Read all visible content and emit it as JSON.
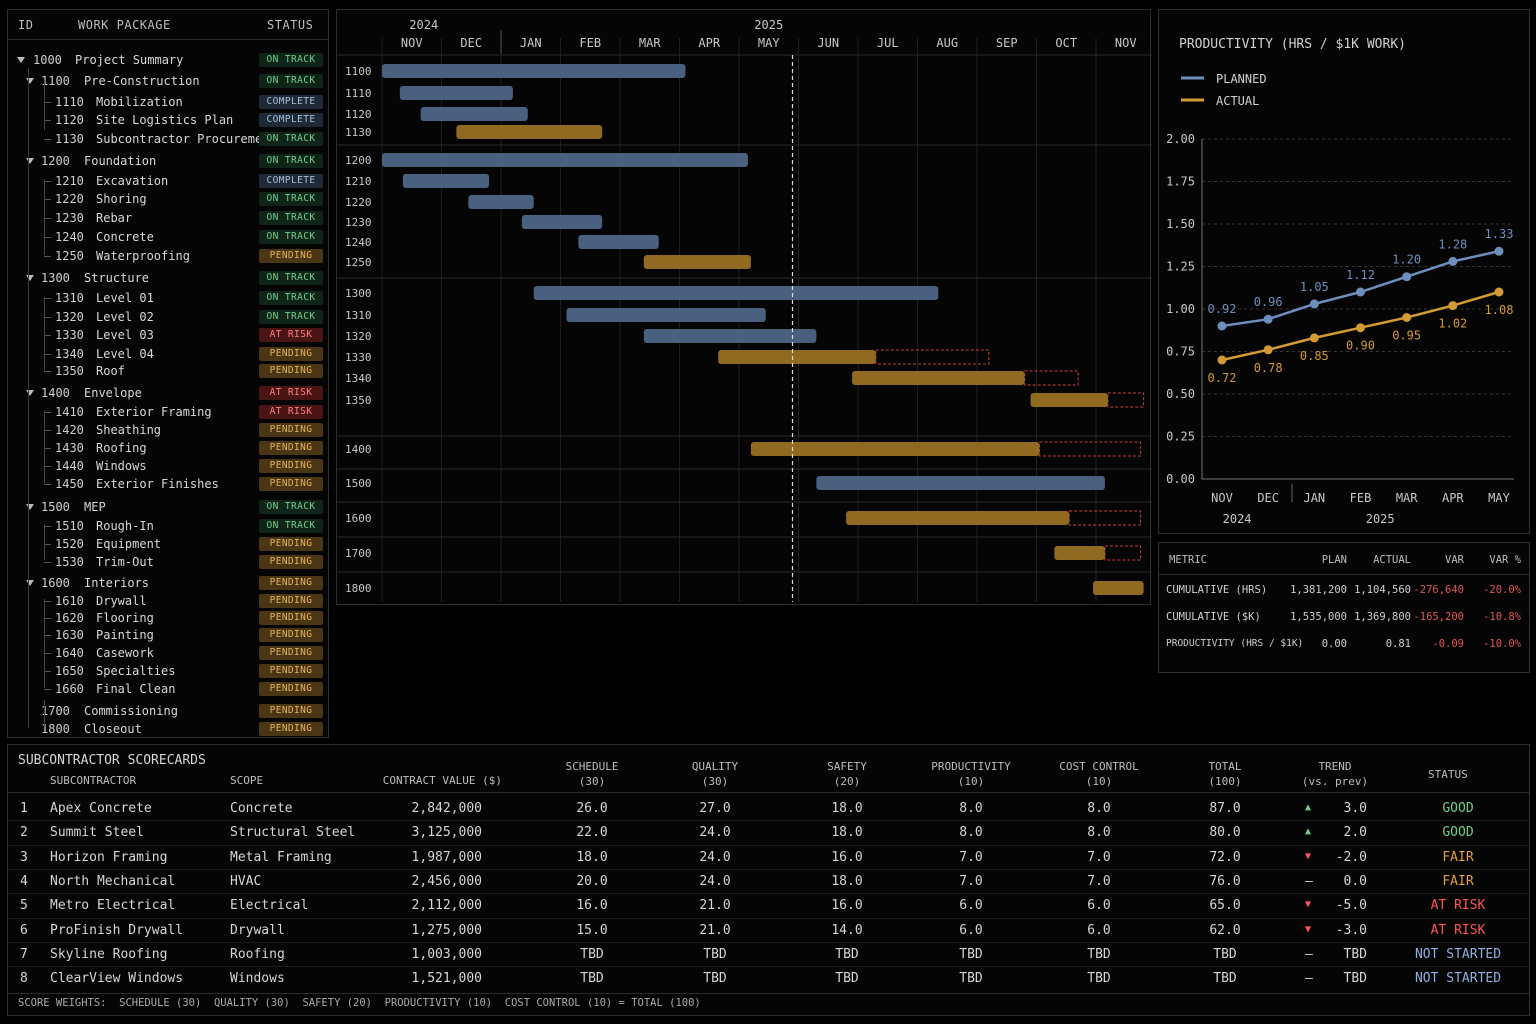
{
  "wbs": {
    "headers": {
      "id": "ID",
      "work_package": "WORK PACKAGE",
      "status": "STATUS"
    },
    "rows": [
      {
        "id": "1000",
        "name": "Project Summary",
        "status": "ON TRACK",
        "level": 0,
        "expand": true
      },
      {
        "id": "1100",
        "name": "Pre-Construction",
        "status": "ON TRACK",
        "level": 1,
        "expand": true
      },
      {
        "id": "1110",
        "name": "Mobilization",
        "status": "COMPLETE",
        "level": 2
      },
      {
        "id": "1120",
        "name": "Site Logistics Plan",
        "status": "COMPLETE",
        "level": 2
      },
      {
        "id": "1130",
        "name": "Subcontractor Procurement",
        "status": "ON TRACK",
        "level": 2
      },
      {
        "id": "1200",
        "name": "Foundation",
        "status": "ON TRACK",
        "level": 1,
        "expand": true
      },
      {
        "id": "1210",
        "name": "Excavation",
        "status": "COMPLETE",
        "level": 2
      },
      {
        "id": "1220",
        "name": "Shoring",
        "status": "ON TRACK",
        "level": 2
      },
      {
        "id": "1230",
        "name": "Rebar",
        "status": "ON TRACK",
        "level": 2
      },
      {
        "id": "1240",
        "name": "Concrete",
        "status": "ON TRACK",
        "level": 2
      },
      {
        "id": "1250",
        "name": "Waterproofing",
        "status": "PENDING",
        "level": 2
      },
      {
        "id": "1300",
        "name": "Structure",
        "status": "ON TRACK",
        "level": 1,
        "expand": true
      },
      {
        "id": "1310",
        "name": "Level 01",
        "status": "ON TRACK",
        "level": 2
      },
      {
        "id": "1320",
        "name": "Level 02",
        "status": "ON TRACK",
        "level": 2
      },
      {
        "id": "1330",
        "name": "Level 03",
        "status": "AT RISK",
        "level": 2
      },
      {
        "id": "1340",
        "name": "Level 04",
        "status": "PENDING",
        "level": 2
      },
      {
        "id": "1350",
        "name": "Roof",
        "status": "PENDING",
        "level": 2
      },
      {
        "id": "1400",
        "name": "Envelope",
        "status": "AT RISK",
        "level": 1,
        "expand": true
      },
      {
        "id": "1410",
        "name": "Exterior Framing",
        "status": "AT RISK",
        "level": 2
      },
      {
        "id": "1420",
        "name": "Sheathing",
        "status": "PENDING",
        "level": 2
      },
      {
        "id": "1430",
        "name": "Roofing",
        "status": "PENDING",
        "level": 2
      },
      {
        "id": "1440",
        "name": "Windows",
        "status": "PENDING",
        "level": 2
      },
      {
        "id": "1450",
        "name": "Exterior Finishes",
        "status": "PENDING",
        "level": 2
      },
      {
        "id": "1500",
        "name": "MEP",
        "status": "ON TRACK",
        "level": 1,
        "expand": true
      },
      {
        "id": "1510",
        "name": "Rough-In",
        "status": "ON TRACK",
        "level": 2
      },
      {
        "id": "1520",
        "name": "Equipment",
        "status": "PENDING",
        "level": 2
      },
      {
        "id": "1530",
        "name": "Trim-Out",
        "status": "PENDING",
        "level": 2
      },
      {
        "id": "1600",
        "name": "Interiors",
        "status": "PENDING",
        "level": 1,
        "expand": true
      },
      {
        "id": "1610",
        "name": "Drywall",
        "status": "PENDING",
        "level": 2
      },
      {
        "id": "1620",
        "name": "Flooring",
        "status": "PENDING",
        "level": 2
      },
      {
        "id": "1630",
        "name": "Painting",
        "status": "PENDING",
        "level": 2
      },
      {
        "id": "1640",
        "name": "Casework",
        "status": "PENDING",
        "level": 2
      },
      {
        "id": "1650",
        "name": "Specialties",
        "status": "PENDING",
        "level": 2
      },
      {
        "id": "1660",
        "name": "Final Clean",
        "status": "PENDING",
        "level": 2
      },
      {
        "id": "1700",
        "name": "Commissioning",
        "status": "PENDING",
        "level": 1
      },
      {
        "id": "1800",
        "name": "Closeout",
        "status": "PENDING",
        "level": 1
      }
    ]
  },
  "colors": {
    "planned": "#6e8fbd",
    "actual": "#d39a35",
    "risk_outline": "#c94040",
    "bar_blue": "#4a607f",
    "bar_orange": "#8f6a20"
  },
  "chart_data": [
    {
      "type": "bar",
      "title": "",
      "years": [
        {
          "label": "2024",
          "month": "NOV"
        },
        {
          "label": "2025",
          "month": "MAY"
        }
      ],
      "months": [
        "NOV",
        "DEC",
        "JAN",
        "FEB",
        "MAR",
        "APR",
        "MAY",
        "JUN",
        "JUL",
        "AUG",
        "SEP",
        "OCT",
        "NOV"
      ],
      "today_month_index": 7.0,
      "tasks": [
        {
          "id": "1100",
          "start": 0.0,
          "end": 5.1,
          "status": "blue"
        },
        {
          "id": "1110",
          "start": 0.3,
          "end": 2.2,
          "status": "blue"
        },
        {
          "id": "1120",
          "start": 0.65,
          "end": 2.45,
          "status": "blue"
        },
        {
          "id": "1130",
          "start": 1.25,
          "end": 3.7,
          "status": "orange"
        },
        {
          "id": "1200",
          "start": 0.0,
          "end": 6.15,
          "status": "blue"
        },
        {
          "id": "1210",
          "start": 0.35,
          "end": 1.8,
          "status": "blue"
        },
        {
          "id": "1220",
          "start": 1.45,
          "end": 2.55,
          "status": "blue"
        },
        {
          "id": "1230",
          "start": 2.35,
          "end": 3.7,
          "status": "blue"
        },
        {
          "id": "1240",
          "start": 3.3,
          "end": 4.65,
          "status": "blue"
        },
        {
          "id": "1250",
          "start": 4.4,
          "end": 6.2,
          "status": "orange"
        },
        {
          "id": "1300",
          "start": 2.55,
          "end": 9.35,
          "status": "blue"
        },
        {
          "id": "1310",
          "start": 3.1,
          "end": 6.45,
          "status": "blue"
        },
        {
          "id": "1320",
          "start": 4.4,
          "end": 7.3,
          "status": "blue"
        },
        {
          "id": "1330",
          "start": 5.65,
          "end": 8.3,
          "status": "orange",
          "ext_end": 10.2
        },
        {
          "id": "1340",
          "start": 7.9,
          "end": 10.8,
          "status": "orange",
          "ext_end": 11.7
        },
        {
          "id": "1350",
          "start": 10.9,
          "end": 12.2,
          "status": "orange",
          "ext_end": 12.8
        },
        {
          "id": "1400",
          "start": 6.2,
          "end": 11.05,
          "status": "orange",
          "ext_end": 12.75
        },
        {
          "id": "1500",
          "start": 7.3,
          "end": 12.15,
          "status": "blue"
        },
        {
          "id": "1600",
          "start": 7.8,
          "end": 11.55,
          "status": "orange",
          "ext_end": 12.75
        },
        {
          "id": "1700",
          "start": 11.3,
          "end": 12.15,
          "status": "orange",
          "ext_end": 12.75
        },
        {
          "id": "1800",
          "start": 11.95,
          "end": 12.8,
          "status": "orange"
        }
      ]
    },
    {
      "type": "line",
      "title": "PRODUCTIVITY (HRS / $1K WORK)",
      "categories": [
        "NOV",
        "DEC",
        "JAN",
        "FEB",
        "MAR",
        "APR",
        "MAY"
      ],
      "years": [
        {
          "label": "2024",
          "index": 0.5
        },
        {
          "label": "2025",
          "index": 3.6
        }
      ],
      "ylim": [
        0,
        2
      ],
      "yticks": [
        "0.00",
        "0.25",
        "0.50",
        "0.75",
        "1.00",
        "1.25",
        "1.50",
        "1.75",
        "2.00"
      ],
      "series": [
        {
          "name": "PLANNED",
          "values": [
            0.9,
            0.94,
            1.03,
            1.1,
            1.19,
            1.28,
            1.34
          ],
          "labels": [
            "0.92",
            "0.96",
            "1.05",
            "1.12",
            "1.20",
            "1.28",
            "1.33"
          ]
        },
        {
          "name": "ACTUAL",
          "values": [
            0.7,
            0.76,
            0.83,
            0.89,
            0.95,
            1.02,
            1.1
          ],
          "labels": [
            "0.72",
            "0.78",
            "0.85",
            "0.90",
            "0.95",
            "1.02",
            "1.08"
          ]
        }
      ]
    }
  ],
  "metrics": {
    "headers": [
      "METRIC",
      "PLAN",
      "ACTUAL",
      "VAR",
      "VAR %"
    ],
    "rows": [
      [
        "CUMULATIVE (HRS)",
        "1,381,200",
        "1,104,560",
        "-276,640",
        "-20.0%"
      ],
      [
        "CUMULATIVE ($K)",
        "1,535,000",
        "1,369,800",
        "-165,200",
        "-10.8%"
      ],
      [
        "PRODUCTIVITY (HRS / $1K)",
        "0.00",
        "0.81",
        "-0.09",
        "-10.0%"
      ]
    ]
  },
  "scorecards": {
    "title": "SUBCONTRACTOR SCORECARDS",
    "headers": {
      "subcontractor": "SUBCONTRACTOR",
      "scope": "SCOPE",
      "contract": "CONTRACT VALUE ($)",
      "schedule": [
        "SCHEDULE",
        "(30)"
      ],
      "quality": [
        "QUALITY",
        "(30)"
      ],
      "safety": [
        "SAFETY",
        "(20)"
      ],
      "productivity": [
        "PRODUCTIVITY",
        "(10)"
      ],
      "cost": [
        "COST CONTROL",
        "(10)"
      ],
      "total": [
        "TOTAL",
        "(100)"
      ],
      "trend": [
        "TREND",
        "(vs. prev)"
      ],
      "status": "STATUS"
    },
    "rows": [
      {
        "n": "1",
        "name": "Apex Concrete",
        "scope": "Concrete",
        "value": "2,842,000",
        "schedule": "26.0",
        "quality": "27.0",
        "safety": "18.0",
        "productivity": "8.0",
        "cost": "8.0",
        "total": "87.0",
        "trend": "up",
        "delta": "3.0",
        "status": "GOOD"
      },
      {
        "n": "2",
        "name": "Summit Steel",
        "scope": "Structural Steel",
        "value": "3,125,000",
        "schedule": "22.0",
        "quality": "24.0",
        "safety": "18.0",
        "productivity": "8.0",
        "cost": "8.0",
        "total": "80.0",
        "trend": "up",
        "delta": "2.0",
        "status": "GOOD"
      },
      {
        "n": "3",
        "name": "Horizon Framing",
        "scope": "Metal Framing",
        "value": "1,987,000",
        "schedule": "18.0",
        "quality": "24.0",
        "safety": "16.0",
        "productivity": "7.0",
        "cost": "7.0",
        "total": "72.0",
        "trend": "down",
        "delta": "-2.0",
        "status": "FAIR"
      },
      {
        "n": "4",
        "name": "North Mechanical",
        "scope": "HVAC",
        "value": "2,456,000",
        "schedule": "20.0",
        "quality": "24.0",
        "safety": "18.0",
        "productivity": "7.0",
        "cost": "7.0",
        "total": "76.0",
        "trend": "flat",
        "delta": "0.0",
        "status": "FAIR"
      },
      {
        "n": "5",
        "name": "Metro Electrical",
        "scope": "Electrical",
        "value": "2,112,000",
        "schedule": "16.0",
        "quality": "21.0",
        "safety": "16.0",
        "productivity": "6.0",
        "cost": "6.0",
        "total": "65.0",
        "trend": "down",
        "delta": "-5.0",
        "status": "AT RISK"
      },
      {
        "n": "6",
        "name": "ProFinish Drywall",
        "scope": "Drywall",
        "value": "1,275,000",
        "schedule": "15.0",
        "quality": "21.0",
        "safety": "14.0",
        "productivity": "6.0",
        "cost": "6.0",
        "total": "62.0",
        "trend": "down",
        "delta": "-3.0",
        "status": "AT RISK"
      },
      {
        "n": "7",
        "name": "Skyline Roofing",
        "scope": "Roofing",
        "value": "1,003,000",
        "schedule": "TBD",
        "quality": "TBD",
        "safety": "TBD",
        "productivity": "TBD",
        "cost": "TBD",
        "total": "TBD",
        "trend": "flat",
        "delta": "TBD",
        "status": "NOT STARTED"
      },
      {
        "n": "8",
        "name": "ClearView Windows",
        "scope": "Windows",
        "value": "1,521,000",
        "schedule": "TBD",
        "quality": "TBD",
        "safety": "TBD",
        "productivity": "TBD",
        "cost": "TBD",
        "total": "TBD",
        "trend": "flat",
        "delta": "TBD",
        "status": "NOT STARTED"
      }
    ],
    "footer": "SCORE WEIGHTS:  SCHEDULE (30)  QUALITY (30)  SAFETY (20)  PRODUCTIVITY (10)  COST CONTROL (10) = TOTAL (100)"
  }
}
